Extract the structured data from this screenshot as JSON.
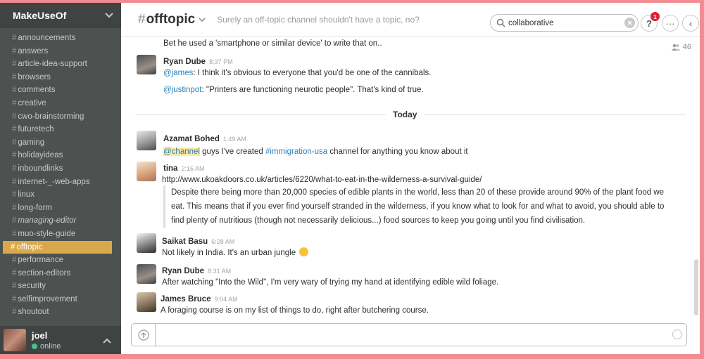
{
  "team": {
    "name": "MakeUseOf"
  },
  "channels": [
    {
      "name": "announcements",
      "active": false,
      "italic": false
    },
    {
      "name": "answers",
      "active": false,
      "italic": false
    },
    {
      "name": "article-idea-support",
      "active": false,
      "italic": false
    },
    {
      "name": "browsers",
      "active": false,
      "italic": false
    },
    {
      "name": "comments",
      "active": false,
      "italic": false
    },
    {
      "name": "creative",
      "active": false,
      "italic": false
    },
    {
      "name": "cwo-brainstorming",
      "active": false,
      "italic": false
    },
    {
      "name": "futuretech",
      "active": false,
      "italic": false
    },
    {
      "name": "gaming",
      "active": false,
      "italic": false
    },
    {
      "name": "holidayideas",
      "active": false,
      "italic": false
    },
    {
      "name": "inboundlinks",
      "active": false,
      "italic": false
    },
    {
      "name": "internet-_-web-apps",
      "active": false,
      "italic": false
    },
    {
      "name": "linux",
      "active": false,
      "italic": false
    },
    {
      "name": "long-form",
      "active": false,
      "italic": false
    },
    {
      "name": "managing-editor",
      "active": false,
      "italic": true
    },
    {
      "name": "muo-style-guide",
      "active": false,
      "italic": false
    },
    {
      "name": "offtopic",
      "active": true,
      "italic": false
    },
    {
      "name": "performance",
      "active": false,
      "italic": false
    },
    {
      "name": "section-editors",
      "active": false,
      "italic": false
    },
    {
      "name": "security",
      "active": false,
      "italic": false
    },
    {
      "name": "selfimprovement",
      "active": false,
      "italic": false
    },
    {
      "name": "shoutout",
      "active": false,
      "italic": false
    }
  ],
  "hash_symbol": "#",
  "user": {
    "name": "joel",
    "status": "online"
  },
  "header": {
    "channel": "offtopic",
    "topic": "Surely an off-topic channel shouldn't have a topic, no?",
    "search_value": "collaborative",
    "help_label": "?",
    "help_badge": "1",
    "more_label": "···",
    "collapse_label": "‹",
    "member_count": "46"
  },
  "messages": {
    "m0": {
      "text": "Bet he used a 'smartphone or similar device' to write that on.."
    },
    "m1": {
      "author": "Ryan Dube",
      "time": "8:37 PM",
      "line1_mention": "@james",
      "line1_text": ": I think it's obvious to everyone that you'd be one of the cannibals.",
      "line2_mention": "@justinpot",
      "line2_text": ": \"Printers are functioning neurotic people\". That's kind of true."
    },
    "day_divider": "Today",
    "m2": {
      "author": "Azamat Bohed",
      "time": "1:49 AM",
      "mention": "@channel",
      "text_a": " guys I've created ",
      "channel_link": "#immigration-usa",
      "text_b": " channel for anything you know about it"
    },
    "m3": {
      "author": "tina",
      "time": "2:16 AM",
      "link": "http://www.ukoakdoors.co.uk/articles/6220/what-to-eat-in-the-wilderness-a-survival-guide/",
      "quote": "Despite there being more than 20,000 species of edible plants in the world, less than 20 of these provide around 90% of the plant food we eat. This means that if you ever find yourself stranded in the wilderness, if you know what to look for and what to avoid, you should able to find plenty of nutritious (though not necessarily delicious...) food sources to keep you going until you find civilisation."
    },
    "m4": {
      "author": "Saikat Basu",
      "time": "6:28 AM",
      "text": "Not likely in India. It's an urban jungle"
    },
    "m5": {
      "author": "Ryan Dube",
      "time": "8:31 AM",
      "text": "After watching \"Into the Wild\", I'm very wary of trying my hand at identifying edible wild foliage."
    },
    "m6": {
      "author": "James Bruce",
      "time": "9:04 AM",
      "text": "A foraging course is on my list of things to do, right after butchering course."
    }
  },
  "composer": {
    "placeholder": ""
  },
  "colors": {
    "sidebar": "#4d5250",
    "active_channel": "#d9a84c",
    "link": "#2a80b9",
    "presence": "#48c08a",
    "badge": "#e01e36",
    "frame": "#f28b93"
  }
}
